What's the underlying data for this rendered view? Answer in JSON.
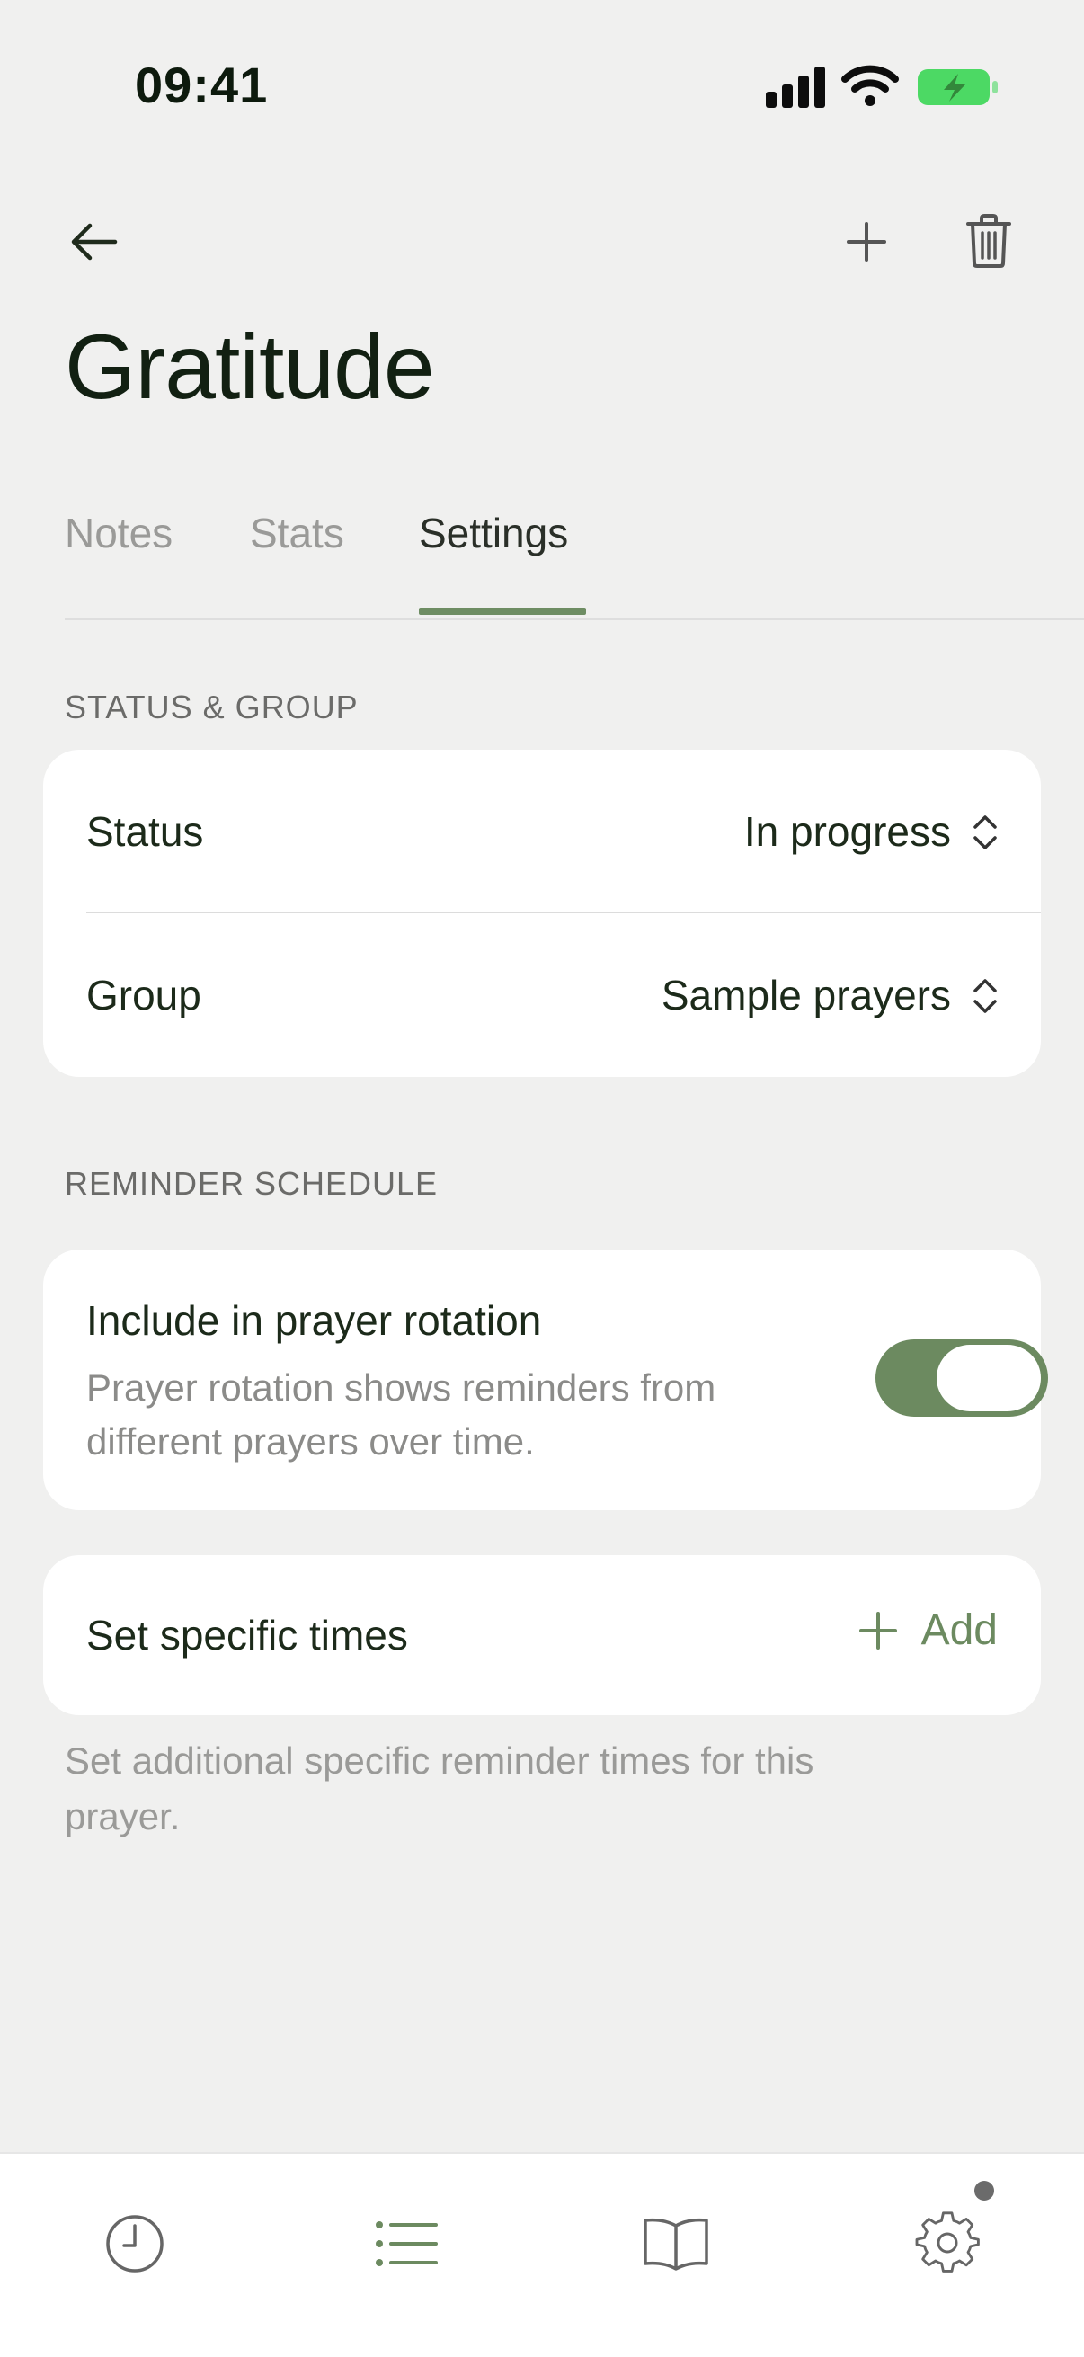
{
  "status_bar": {
    "time": "09:41"
  },
  "header": {
    "title": "Gratitude",
    "icons": [
      "arrow-left-icon",
      "plus-icon",
      "trash-icon"
    ]
  },
  "tabs": [
    {
      "label": "Notes",
      "active": false
    },
    {
      "label": "Stats",
      "active": false
    },
    {
      "label": "Settings",
      "active": true
    }
  ],
  "status_group": {
    "section_label": "STATUS & GROUP",
    "status_label": "Status",
    "status_value": "In progress",
    "group_label": "Group",
    "group_value": "Sample prayers"
  },
  "reminder_schedule": {
    "section_label": "REMINDER SCHEDULE",
    "rotation_title": "Include in prayer rotation",
    "rotation_description": "Prayer rotation shows reminders from different prayers over time.",
    "rotation_enabled": true,
    "specific_times_label": "Set specific times",
    "add_label": "Add",
    "helper_text": "Set additional specific reminder times for this prayer."
  },
  "bottom_nav": {
    "items": [
      "clock-icon",
      "list-icon",
      "book-icon",
      "gear-icon"
    ],
    "active": "list-icon"
  },
  "colors": {
    "accent": "#6c8a60",
    "background": "#f0f0ef",
    "card": "#ffffff",
    "text": "#1c2a1a",
    "muted": "#9a9a98"
  }
}
